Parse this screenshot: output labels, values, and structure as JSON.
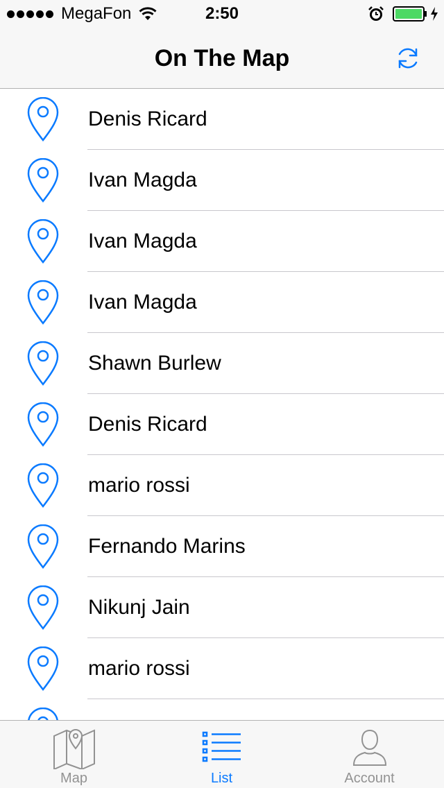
{
  "status_bar": {
    "carrier": "MegaFon",
    "time": "2:50",
    "battery_color": "#4cd964"
  },
  "nav_bar": {
    "title": "On The Map",
    "refresh_icon": "refresh-icon"
  },
  "list": {
    "items": [
      {
        "name": "Denis Ricard"
      },
      {
        "name": "Ivan Magda"
      },
      {
        "name": "Ivan Magda"
      },
      {
        "name": "Ivan Magda"
      },
      {
        "name": "Shawn Burlew"
      },
      {
        "name": "Denis Ricard"
      },
      {
        "name": "mario rossi"
      },
      {
        "name": "Fernando Marins"
      },
      {
        "name": "Nikunj Jain"
      },
      {
        "name": "mario rossi"
      },
      {
        "name": ""
      }
    ]
  },
  "tab_bar": {
    "tabs": [
      {
        "label": "Map",
        "icon": "map-icon",
        "active": false
      },
      {
        "label": "List",
        "icon": "list-icon",
        "active": true
      },
      {
        "label": "Account",
        "icon": "account-icon",
        "active": false
      }
    ]
  },
  "colors": {
    "accent": "#0a7aff",
    "inactive": "#929292"
  }
}
